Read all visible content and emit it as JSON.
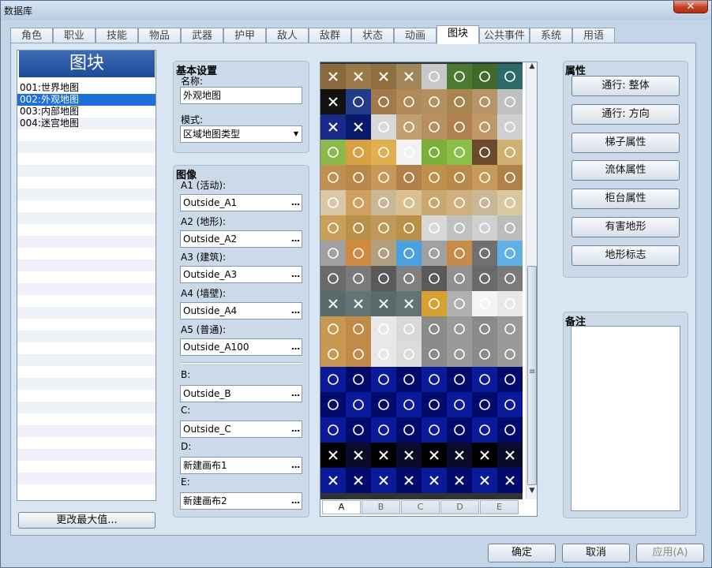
{
  "window": {
    "title": "数据库",
    "close_glyph": "✕"
  },
  "tabs": [
    "角色",
    "职业",
    "技能",
    "物品",
    "武器",
    "护甲",
    "敌人",
    "敌群",
    "状态",
    "动画",
    "图块",
    "公共事件",
    "系统",
    "用语"
  ],
  "active_tab": 10,
  "tileset_list": {
    "header": "图块",
    "items": [
      "001:世界地图",
      "002:外观地图",
      "003:内部地图",
      "004:迷宫地图"
    ],
    "selected": 1,
    "change_max_button": "更改最大值..."
  },
  "basic": {
    "title": "基本设置",
    "name_label": "名称:",
    "name_value": "外观地图",
    "mode_label": "模式:",
    "mode_value": "区域地图类型"
  },
  "images": {
    "title": "图像",
    "rows": [
      {
        "label": "A1 (活动):",
        "value": "Outside_A1"
      },
      {
        "label": "A2 (地形):",
        "value": "Outside_A2"
      },
      {
        "label": "A3 (建筑):",
        "value": "Outside_A3"
      },
      {
        "label": "A4 (墙壁):",
        "value": "Outside_A4"
      },
      {
        "label": "A5 (普通):",
        "value": "Outside_A100"
      },
      {
        "label": "B:",
        "value": "Outside_B"
      },
      {
        "label": "C:",
        "value": "Outside_C"
      },
      {
        "label": "D:",
        "value": "新建画布1"
      },
      {
        "label": "E:",
        "value": "新建画布2"
      }
    ],
    "browse_glyph": "…"
  },
  "tile_pages": [
    "A",
    "B",
    "C",
    "D",
    "E"
  ],
  "active_page": 0,
  "scroll": {
    "up": "▲",
    "down": "▼",
    "grip": "≡"
  },
  "attributes": {
    "title": "属性",
    "buttons": [
      "通行: 整体",
      "通行: 方向",
      "梯子属性",
      "流体属性",
      "柜台属性",
      "有害地形",
      "地形标志"
    ]
  },
  "notes": {
    "title": "备注"
  },
  "dialog_buttons": {
    "ok": "确定",
    "cancel": "取消",
    "apply": "应用(A)"
  },
  "colors": {
    "accent_blue": "#1e4b99",
    "selection_blue": "#1e6fd9"
  }
}
